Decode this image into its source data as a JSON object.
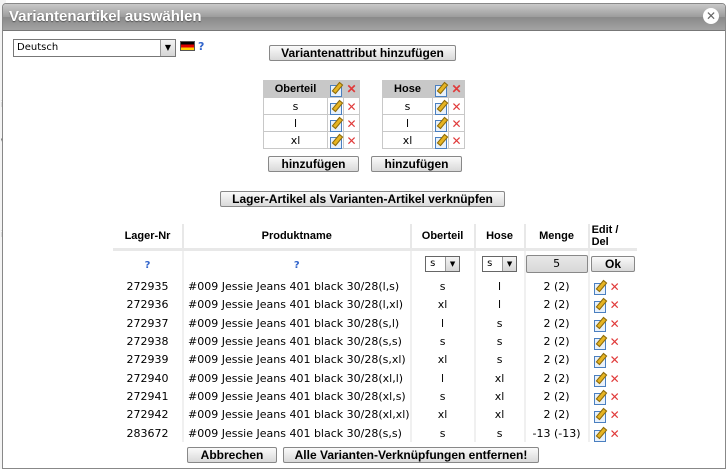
{
  "dialog": {
    "title": "Variantenartikel auswählen",
    "close_icon": "close-icon"
  },
  "language": {
    "selected": "Deutsch",
    "flag": "german-flag-icon",
    "help": "?"
  },
  "buttons": {
    "add_attribute": "Variantenattribut hinzufügen",
    "add": "hinzufügen",
    "link_stock": "Lager-Artikel als Varianten-Artikel verknüpfen",
    "cancel": "Abbrechen",
    "remove_all": "Alle Varianten-Verknüpfungen entfernen!",
    "ok": "Ok"
  },
  "attributes": [
    {
      "name": "Oberteil",
      "values": [
        "s",
        "l",
        "xl"
      ]
    },
    {
      "name": "Hose",
      "values": [
        "s",
        "l",
        "xl"
      ]
    }
  ],
  "table": {
    "headers": [
      "Lager-Nr",
      "Produktname",
      "Oberteil",
      "Hose",
      "Menge",
      "Edit / Del"
    ],
    "filter": {
      "lager_help": "?",
      "name_help": "?",
      "oberteil": "s",
      "hose": "s",
      "menge": "5"
    },
    "rows": [
      {
        "nr": "272935",
        "name": "#009 Jessie Jeans 401 black 30/28(l,s)",
        "oberteil": "s",
        "hose": "l",
        "menge": "2 (2)"
      },
      {
        "nr": "272936",
        "name": "#009 Jessie Jeans 401 black 30/28(l,xl)",
        "oberteil": "xl",
        "hose": "l",
        "menge": "2 (2)"
      },
      {
        "nr": "272937",
        "name": "#009 Jessie Jeans 401 black 30/28(s,l)",
        "oberteil": "l",
        "hose": "s",
        "menge": "2 (2)"
      },
      {
        "nr": "272938",
        "name": "#009 Jessie Jeans 401 black 30/28(s,s)",
        "oberteil": "s",
        "hose": "s",
        "menge": "2 (2)"
      },
      {
        "nr": "272939",
        "name": "#009 Jessie Jeans 401 black 30/28(s,xl)",
        "oberteil": "xl",
        "hose": "s",
        "menge": "2 (2)"
      },
      {
        "nr": "272940",
        "name": "#009 Jessie Jeans 401 black 30/28(xl,l)",
        "oberteil": "l",
        "hose": "xl",
        "menge": "2 (2)"
      },
      {
        "nr": "272941",
        "name": "#009 Jessie Jeans 401 black 30/28(xl,s)",
        "oberteil": "s",
        "hose": "xl",
        "menge": "2 (2)"
      },
      {
        "nr": "272942",
        "name": "#009 Jessie Jeans 401 black 30/28(xl,xl)",
        "oberteil": "xl",
        "hose": "xl",
        "menge": "2 (2)"
      },
      {
        "nr": "283672",
        "name": "#009 Jessie Jeans 401 black 30/28(s,s)",
        "oberteil": "s",
        "hose": "s",
        "menge": "-13 (-13)"
      }
    ]
  },
  "colors": {
    "titlebar": "#9c9c9c",
    "help": "#3366cc",
    "delete": "#e03a3a"
  }
}
